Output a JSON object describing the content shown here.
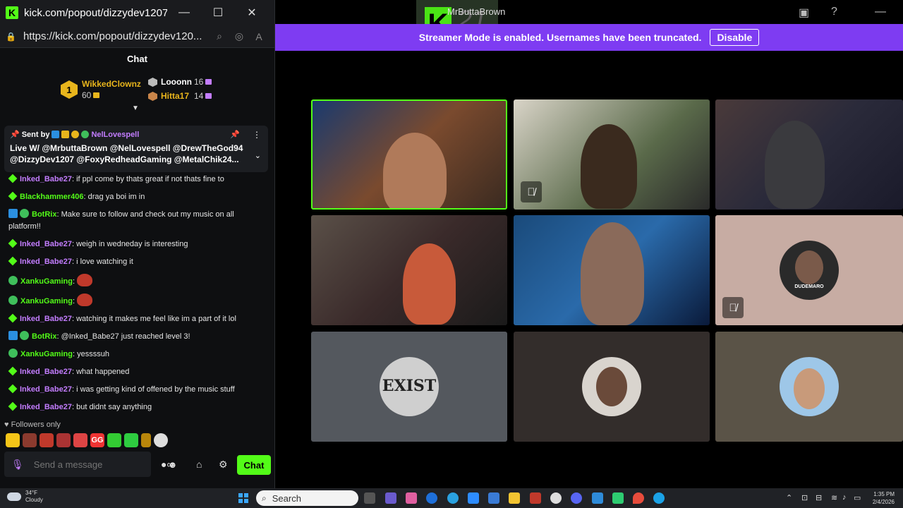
{
  "window": {
    "title": "kick.com/popout/dizzydev1207...",
    "url": "https://kick.com/popout/dizzydev120...",
    "logo": "K"
  },
  "chat": {
    "header": "Chat",
    "leaderboard": [
      {
        "rank": "1",
        "name": "WikkedClownz",
        "value": "60"
      },
      {
        "rank": "2",
        "name": "Looonn",
        "value": "16"
      },
      {
        "rank": "3",
        "name": "Hitta17",
        "value": "14"
      }
    ],
    "pinned": {
      "sent_by_label": "Sent by",
      "author": "NelLovespell",
      "text": "Live W/ @MrbuttaBrown @NelLovespell @DrewTheGod94 @DizzyDev1207 @FoxyRedheadGaming @MetalChik24..."
    },
    "messages": [
      {
        "user": "Inked_Babe27",
        "text": ": if ppl come by thats great if not thats fine to",
        "badge": "gift",
        "color": "#c37dff"
      },
      {
        "user": "Blackhammer406",
        "text": ": drag ya boi im in",
        "badge": "gift",
        "color": "#53fc18"
      },
      {
        "user": "BotRix",
        "text": ": Make sure to follow and check out my music on all platform!!",
        "badge": "bot",
        "color": "#53fc18"
      },
      {
        "user": "Inked_Babe27",
        "text": ": weigh in wedneday is interesting",
        "badge": "gift",
        "color": "#c37dff"
      },
      {
        "user": "Inked_Babe27",
        "text": ": i love watching it",
        "badge": "gift",
        "color": "#c37dff"
      },
      {
        "user": "XankuGaming",
        "text": ": ",
        "badge": "verified",
        "color": "#53fc18",
        "emote": true
      },
      {
        "user": "XankuGaming",
        "text": ": ",
        "badge": "verified",
        "color": "#53fc18",
        "emote": true
      },
      {
        "user": "Inked_Babe27",
        "text": ": watching it makes me feel like im a part of it lol",
        "badge": "gift",
        "color": "#c37dff"
      },
      {
        "user": "BotRix",
        "text": ": @Inked_Babe27 just reached level 3!",
        "badge": "bot",
        "color": "#53fc18"
      },
      {
        "user": "XankuGaming",
        "text": ": yessssuh",
        "badge": "verified",
        "color": "#53fc18"
      },
      {
        "user": "Inked_Babe27",
        "text": ": what happened",
        "badge": "gift",
        "color": "#c37dff"
      },
      {
        "user": "Inked_Babe27",
        "text": ": i was getting kind of offened by the music stuff",
        "badge": "gift",
        "color": "#c37dff"
      },
      {
        "user": "Inked_Babe27",
        "text": ": but didnt say anything",
        "badge": "gift",
        "color": "#c37dff"
      }
    ],
    "followers_only": "Followers only",
    "input_placeholder": "Send a message",
    "send_label": "Chat"
  },
  "stream": {
    "host_name": "MrButtaBrown",
    "logo_text": "K",
    "logo_suffix": "21",
    "banner_text": "Streamer Mode is enabled. Usernames have been truncated.",
    "banner_button": "Disable",
    "avatar_text_1": "EXIST",
    "avatar_text_2": "DUDEMARO"
  },
  "taskbar": {
    "temp": "34°F",
    "condition": "Cloudy",
    "search": "Search",
    "time": "1:35 PM",
    "date": "2/4/2026"
  },
  "colors": {
    "accent": "#53fc18",
    "banner": "#7e3cf2",
    "purple_user": "#c37dff",
    "gold": "#e8b51c"
  }
}
